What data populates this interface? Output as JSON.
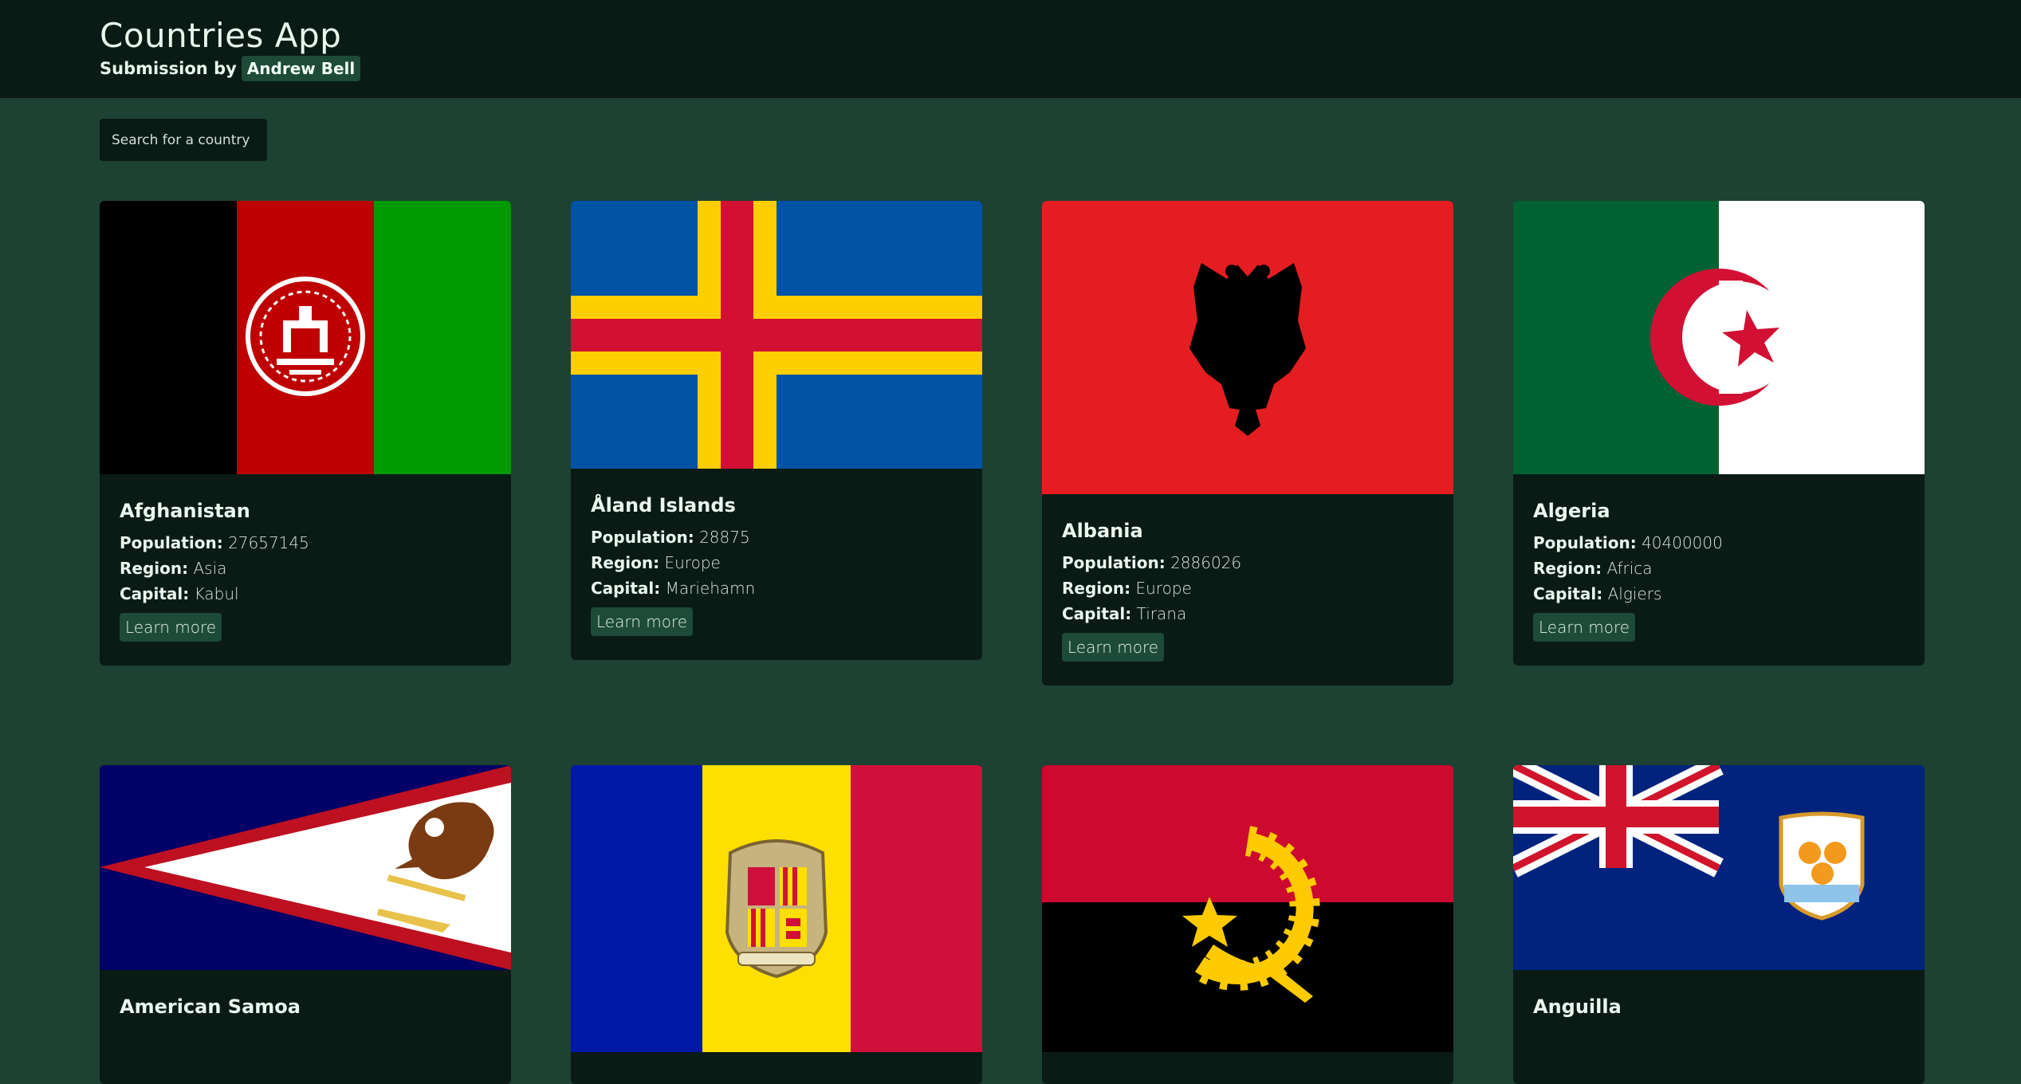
{
  "header": {
    "title": "Countries App",
    "byline_prefix": "Submission by",
    "author": "Andrew Bell"
  },
  "search": {
    "placeholder": "Search for a country"
  },
  "labels": {
    "population": "Population:",
    "region": "Region:",
    "capital": "Capital:",
    "learn_more": "Learn more"
  },
  "countries": [
    {
      "name": "Afghanistan",
      "population": "27657145",
      "region": "Asia",
      "capital": "Kabul",
      "flag_icon": "afghanistan-flag"
    },
    {
      "name": "Åland Islands",
      "population": "28875",
      "region": "Europe",
      "capital": "Mariehamn",
      "flag_icon": "aland-islands-flag"
    },
    {
      "name": "Albania",
      "population": "2886026",
      "region": "Europe",
      "capital": "Tirana",
      "flag_icon": "albania-flag"
    },
    {
      "name": "Algeria",
      "population": "40400000",
      "region": "Africa",
      "capital": "Algiers",
      "flag_icon": "algeria-flag"
    },
    {
      "name": "American Samoa",
      "flag_icon": "american-samoa-flag"
    },
    {
      "name": "",
      "flag_icon": "andorra-flag"
    },
    {
      "name": "",
      "flag_icon": "angola-flag"
    },
    {
      "name": "Anguilla",
      "flag_icon": "anguilla-flag"
    }
  ],
  "colors": {
    "page_background": "#1d4133",
    "header_background": "#0a1a15",
    "card_background": "#0a1a15",
    "accent_button": "#1d4a39"
  }
}
